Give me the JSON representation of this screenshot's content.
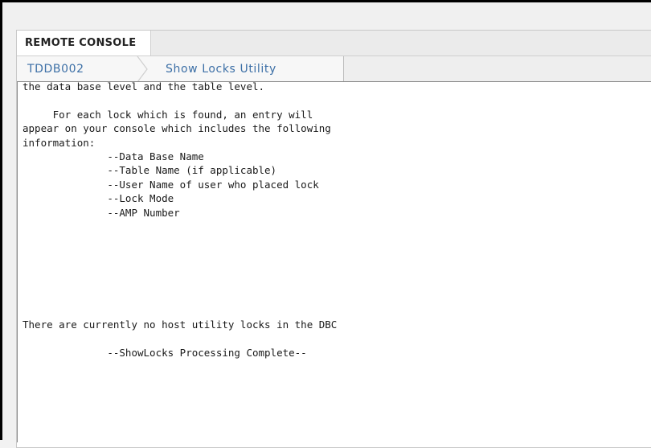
{
  "console": {
    "title": "REMOTE CONSOLE"
  },
  "breadcrumb": {
    "system": "TDDB002",
    "utility": "Show Locks Utility"
  },
  "output": {
    "lines": [
      "the data base level and the table level.",
      "",
      "     For each lock which is found, an entry will",
      "appear on your console which includes the following",
      "information:",
      "              --Data Base Name",
      "              --Table Name (if applicable)",
      "              --User Name of user who placed lock",
      "              --Lock Mode",
      "              --AMP Number",
      "",
      "",
      "",
      "",
      "",
      "",
      "",
      "There are currently no host utility locks in the DBC",
      "",
      "              --ShowLocks Processing Complete--"
    ]
  }
}
